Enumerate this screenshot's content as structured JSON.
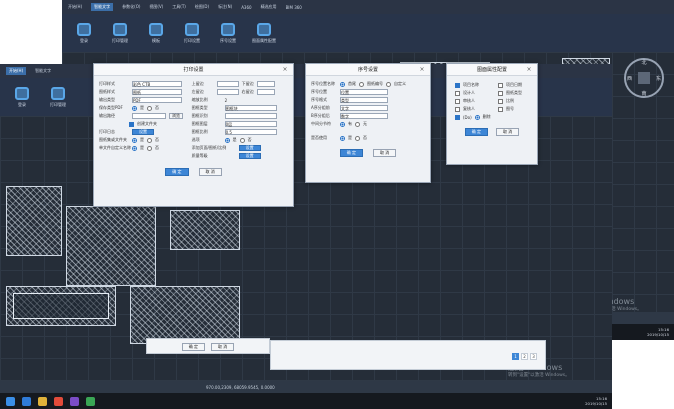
{
  "back_window": {
    "menu": [
      "开始(H)",
      "智能文字",
      "参数化(O)",
      "视图(V)",
      "工具(T)",
      "绘图(D)",
      "标注(N)",
      "A360",
      "精选应用",
      "BIM 360"
    ],
    "ribbon": [
      "登录",
      "打印管理",
      "模板",
      "打印设置",
      "序号设置",
      "图面属性配置"
    ],
    "status_coords": "970.00,2309, 68059.9545, 0.0000",
    "status_scale": "1:1 / 100%",
    "watermark_title": "激活 Windows",
    "watermark_sub": "转到\"设置\"以激活 Windows。",
    "clock_time": "15:16",
    "clock_date": "2019/10/15",
    "compass": {
      "north": "北",
      "south": "南",
      "west": "西",
      "east": "东"
    }
  },
  "front_window": {
    "menu": [
      "开始(H)",
      "智能文字"
    ],
    "ribbon": [
      "登录",
      "打印管理"
    ],
    "status_coords": "970.00,2309, 68059.9545, 0.0000",
    "watermark_title": "激活 Windows",
    "watermark_sub": "转到\"设置\"以激活 Windows。",
    "clock_time": "15:16",
    "clock_date": "2019/10/15"
  },
  "print_dialog": {
    "title": "打印设置",
    "left_rows": [
      {
        "label": "打印样式",
        "value": "彩色 CTB"
      },
      {
        "label": "图纸样式",
        "value": "图纸"
      },
      {
        "label": "输出类型",
        "value": "PDF"
      },
      {
        "label": "保存类型PDF",
        "value": ""
      },
      {
        "label": "输出路径",
        "value": "浏览"
      },
      {
        "label": "",
        "value": "创建文件夹"
      },
      {
        "label": "打印日志",
        "value": "设置"
      },
      {
        "label": "图纸集或文件夹",
        "value": ""
      },
      {
        "label": "单文件自定义名称",
        "value": ""
      }
    ],
    "right_rows": [
      {
        "label": "上留边",
        "value": "",
        "label2": "下留边"
      },
      {
        "label": "左留边",
        "value": "",
        "label2": "右留边"
      },
      {
        "label": "缩放比例",
        "value": "2"
      },
      {
        "label": "图框类型",
        "value": "图框块"
      },
      {
        "label": "图框识别",
        "value": ""
      },
      {
        "label": "图框图层",
        "value": "0层"
      },
      {
        "label": "图框比例",
        "value": "0.5"
      },
      {
        "label": "选项",
        "value": ""
      },
      {
        "label": "添加页面/图纸/比例",
        "value": "设置"
      },
      {
        "label": "质量等级",
        "value": "设置"
      }
    ],
    "radio_yes": "是",
    "radio_no": "否",
    "ok_button": "确 定",
    "cancel_button": "取 消"
  },
  "seq_dialog": {
    "title": "序号设置",
    "rows": [
      {
        "label": "序号位置名称",
        "options": [
          "首尾",
          "图纸编号",
          "自定义"
        ]
      },
      {
        "label": "序号位置",
        "value": "位置"
      },
      {
        "label": "序号格式",
        "value": "类型"
      },
      {
        "label": "A序分组前",
        "value": "文字"
      },
      {
        "label": "B序分组后",
        "value": "数字"
      },
      {
        "label": "中间分节符",
        "options": [
          "有",
          "无"
        ]
      }
    ],
    "row_bottom": "是否使用",
    "radio_yes": "是",
    "radio_no": "否",
    "ok_button": "确 定",
    "cancel_button": "取 消"
  },
  "attr_dialog": {
    "title": "图面属性配置",
    "items": [
      {
        "label": "项目名称",
        "label2": "项目日期",
        "on": true
      },
      {
        "label": "设计人",
        "label2": "图纸类型",
        "on": false
      },
      {
        "label": "审核人",
        "label2": "比例",
        "on": false
      },
      {
        "label": "复核人",
        "label2": "图号",
        "on": false
      },
      {
        "label": "(Do)",
        "label2": "删除",
        "on": true
      }
    ],
    "ok_button": "确 定",
    "cancel_button": "取 消"
  },
  "bottom_slab": {
    "ok_button": "确 定",
    "cancel_button": "取 消",
    "pages": [
      "1",
      "2",
      "3"
    ]
  }
}
